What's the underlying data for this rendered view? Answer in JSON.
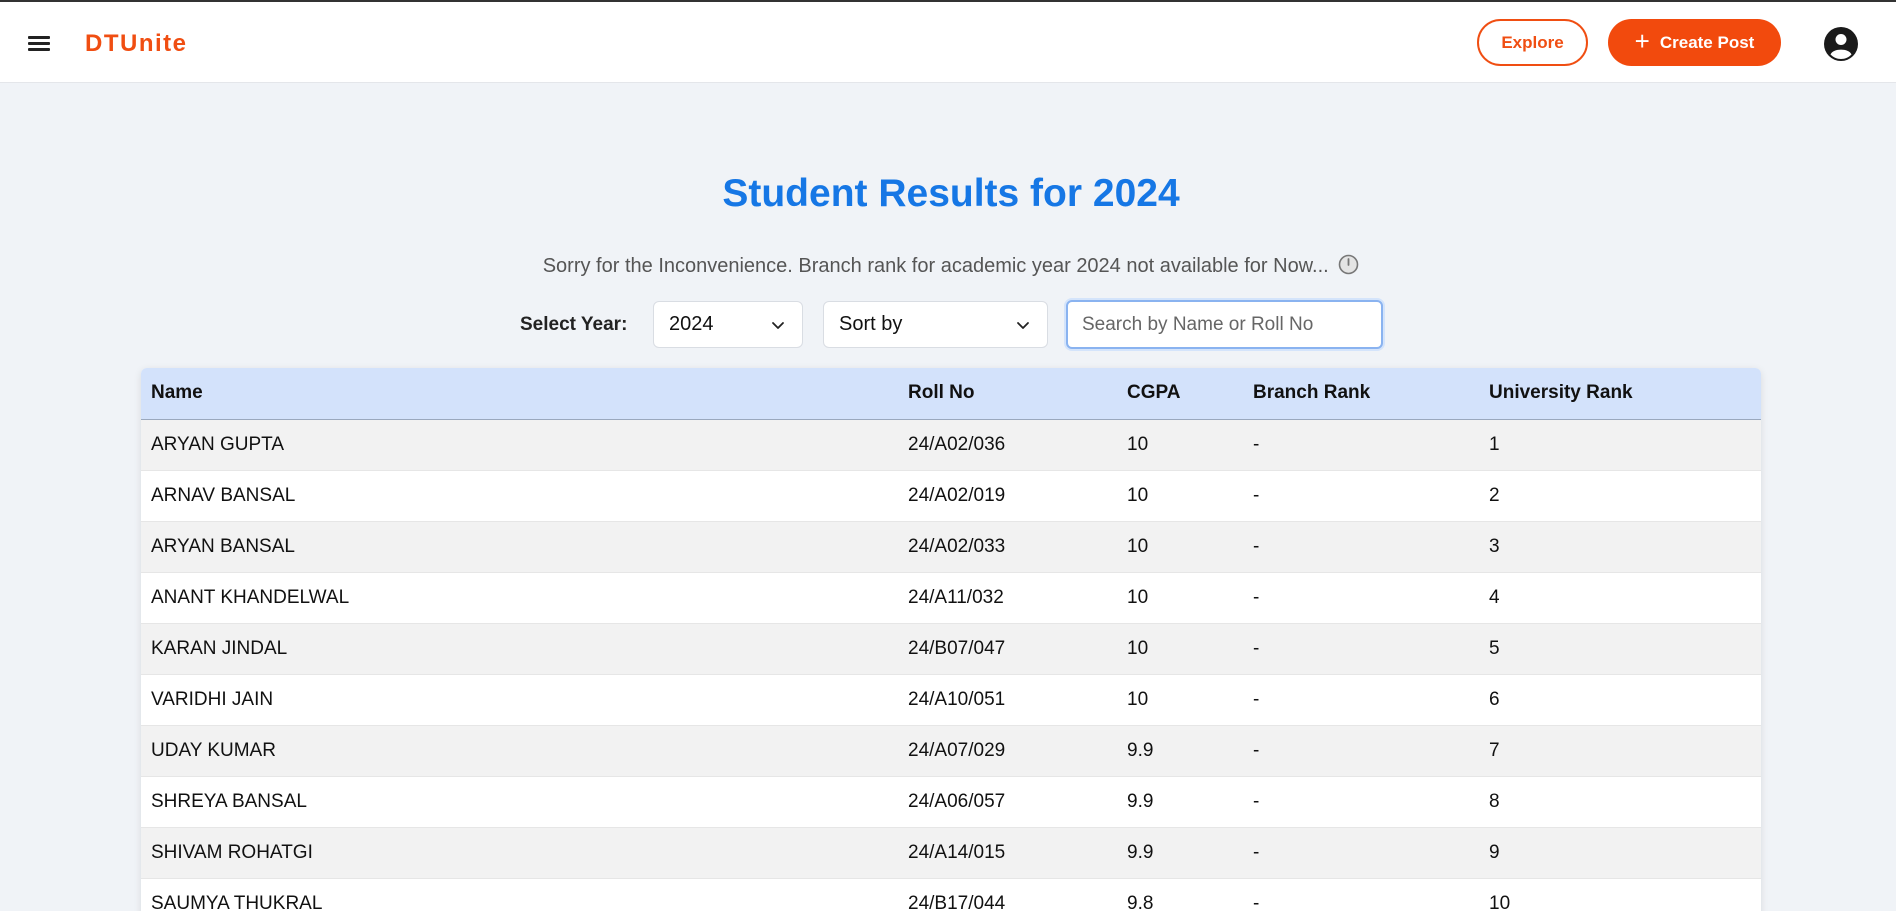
{
  "header": {
    "brand": "DTUnite",
    "explore_label": "Explore",
    "create_post_label": "Create Post",
    "icons": {
      "menu": "menu-icon",
      "plus": "plus-icon",
      "profile": "user-circle-icon"
    },
    "colors": {
      "brand": "#f04e12",
      "primary_button": "#f24a0d"
    }
  },
  "main": {
    "title": "Student Results for 2024",
    "notice": "Sorry for the Inconvenience. Branch rank for academic year 2024 not available for Now...",
    "notice_icon": "clock-icon",
    "title_color": "#1677e5"
  },
  "controls": {
    "year_label": "Select Year:",
    "year_value": "2024",
    "sort_value": "Sort by",
    "search_placeholder": "Search by Name or Roll No"
  },
  "table": {
    "headers": [
      "Name",
      "Roll No",
      "CGPA",
      "Branch Rank",
      "University Rank"
    ],
    "rows": [
      [
        "ARYAN GUPTA",
        "24/A02/036",
        "10",
        "-",
        "1"
      ],
      [
        "ARNAV BANSAL",
        "24/A02/019",
        "10",
        "-",
        "2"
      ],
      [
        "ARYAN BANSAL",
        "24/A02/033",
        "10",
        "-",
        "3"
      ],
      [
        "ANANT KHANDELWAL",
        "24/A11/032",
        "10",
        "-",
        "4"
      ],
      [
        "KARAN JINDAL",
        "24/B07/047",
        "10",
        "-",
        "5"
      ],
      [
        "VARIDHI JAIN",
        "24/A10/051",
        "10",
        "-",
        "6"
      ],
      [
        "UDAY KUMAR",
        "24/A07/029",
        "9.9",
        "-",
        "7"
      ],
      [
        "SHREYA BANSAL",
        "24/A06/057",
        "9.9",
        "-",
        "8"
      ],
      [
        "SHIVAM ROHATGI",
        "24/A14/015",
        "9.9",
        "-",
        "9"
      ],
      [
        "SAUMYA THUKRAL",
        "24/B17/044",
        "9.8",
        "-",
        "10"
      ]
    ]
  }
}
